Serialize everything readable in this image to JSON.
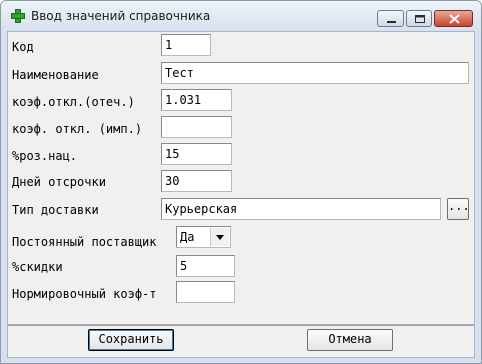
{
  "window": {
    "title": "Ввод значений справочника",
    "icon": "green-cross-icon",
    "controls": [
      "minimize-icon",
      "maximize-icon",
      "close-icon"
    ]
  },
  "form": {
    "code": {
      "label": "Код",
      "value": "1"
    },
    "name": {
      "label": "Наименование",
      "value": "Тест"
    },
    "coef_domestic": {
      "label": "коэф.откл.(отеч.)",
      "value": "1.031"
    },
    "coef_import": {
      "label": "коэф. откл. (имп.)",
      "value": ""
    },
    "markup": {
      "label": "%роз.нац.",
      "value": "15"
    },
    "deferral_days": {
      "label": "Дней отсрочки",
      "value": "30"
    },
    "delivery_type": {
      "label": "Тип доставки",
      "value": "Курьерская",
      "browse_label": "..."
    },
    "permanent_supplier": {
      "label": "Постоянный поставщик",
      "value": "Да"
    },
    "discount": {
      "label": "%скидки",
      "value": "5"
    },
    "norm_coef": {
      "label": "Нормировочный коэф-т",
      "value": ""
    }
  },
  "buttons": {
    "save": "Сохранить",
    "cancel": "Отмена"
  },
  "colors": {
    "title_bar": "#d7e1ef",
    "client_bg": "#f0f0f0",
    "close_button": "#c9442e",
    "icon_green": "#2ea32e"
  }
}
